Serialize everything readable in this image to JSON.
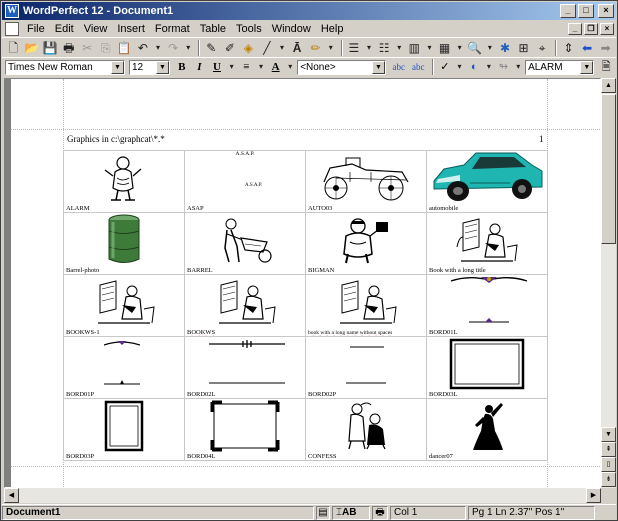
{
  "window": {
    "title": "WordPerfect 12 - Document1"
  },
  "menu": [
    "File",
    "Edit",
    "View",
    "Insert",
    "Format",
    "Table",
    "Tools",
    "Window",
    "Help"
  ],
  "property_bar": {
    "font_name": "Times New Roman",
    "font_size": "12",
    "bold": "B",
    "italic": "I",
    "underline": "U",
    "style": "<None>",
    "abc1": "abc",
    "abc2": "abc",
    "box_name": "ALARM"
  },
  "document": {
    "header": "Graphics in c:\\graphcat\\*.*",
    "page_number": "1",
    "cells": [
      {
        "label": "ALARM",
        "art": "alarm"
      },
      {
        "label": "ASAP",
        "art": "asap",
        "top_text": "A.S.A.P.",
        "mid_text": "A.S.A.P."
      },
      {
        "label": "AUTO03",
        "art": "auto"
      },
      {
        "label": "automobile",
        "art": "car"
      },
      {
        "label": "Barrel-photo",
        "art": "barrel"
      },
      {
        "label": "BARREL",
        "art": "wheelbarrow"
      },
      {
        "label": "BIGMAN",
        "art": "bigman"
      },
      {
        "label": "Book with a long title",
        "art": "reader"
      },
      {
        "label": "BOOKWS-1",
        "art": "reader"
      },
      {
        "label": "BOOKWS",
        "art": "reader"
      },
      {
        "label": "book with a long name without spaces",
        "art": "reader"
      },
      {
        "label": "BORD01L",
        "art": "ornament"
      },
      {
        "label": "BORD01P",
        "art": "ornament-small"
      },
      {
        "label": "BORD02L",
        "art": "line"
      },
      {
        "label": "BORD02P",
        "art": "line-short"
      },
      {
        "label": "BORD03L",
        "art": "frame-wide"
      },
      {
        "label": "BORD03P",
        "art": "frame-tall"
      },
      {
        "label": "BORD04L",
        "art": "frame-corner"
      },
      {
        "label": "CONFESS",
        "art": "confess"
      },
      {
        "label": "dancer07",
        "art": "dancer"
      }
    ]
  },
  "status": {
    "doc": "Document1",
    "ab": "AB",
    "col": "Col 1",
    "pos": "Pg 1 Ln 2.37\" Pos 1\""
  },
  "colors": {
    "title_start": "#0a246a",
    "title_end": "#a6caf0",
    "car": "#1fb5b0",
    "barrel": "#3e7a3a"
  }
}
